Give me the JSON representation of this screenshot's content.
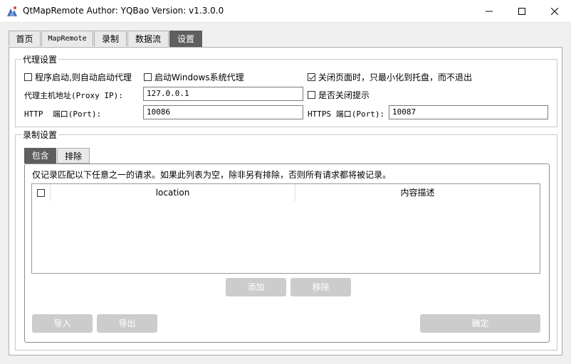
{
  "window": {
    "title": "QtMapRemote Author: YQBao Version: v1.3.0.0"
  },
  "tabs": [
    {
      "label": "首页"
    },
    {
      "label": "MapRemote"
    },
    {
      "label": "录制"
    },
    {
      "label": "数据流"
    },
    {
      "label": "设置"
    }
  ],
  "active_tab": "设置",
  "proxy": {
    "group_title": "代理设置",
    "autostart_proxy": {
      "label": "程序启动,则自动启动代理",
      "checked": false
    },
    "windows_proxy": {
      "label": "启动Windows系统代理",
      "checked": false
    },
    "minimize_to_tray": {
      "label": "关闭页面时，只最小化到托盘，而不退出",
      "checked": true
    },
    "close_prompt": {
      "label": "是否关闭提示",
      "checked": false
    },
    "host_label": "代理主机地址(Proxy IP):",
    "host_value": "127.0.0.1",
    "http_label": "HTTP  端口(Port):",
    "http_value": "10086",
    "https_label": "HTTPS 端口(Port):",
    "https_value": "10087"
  },
  "record": {
    "group_title": "录制设置",
    "subtabs": [
      {
        "label": "包含"
      },
      {
        "label": "排除"
      }
    ],
    "description": "仅记录匹配以下任意之一的请求。如果此列表为空，除非另有排除，否则所有请求都将被记录。",
    "table_headers": {
      "location": "location",
      "desc": "内容描述"
    },
    "add_button": "添加",
    "remove_button": "移除",
    "import_button": "导入",
    "export_button": "导出",
    "ok_button": "确定"
  },
  "colors": {
    "active_tab_bg": "#5f5f5f",
    "disabled_button_bg": "#cccccc"
  }
}
